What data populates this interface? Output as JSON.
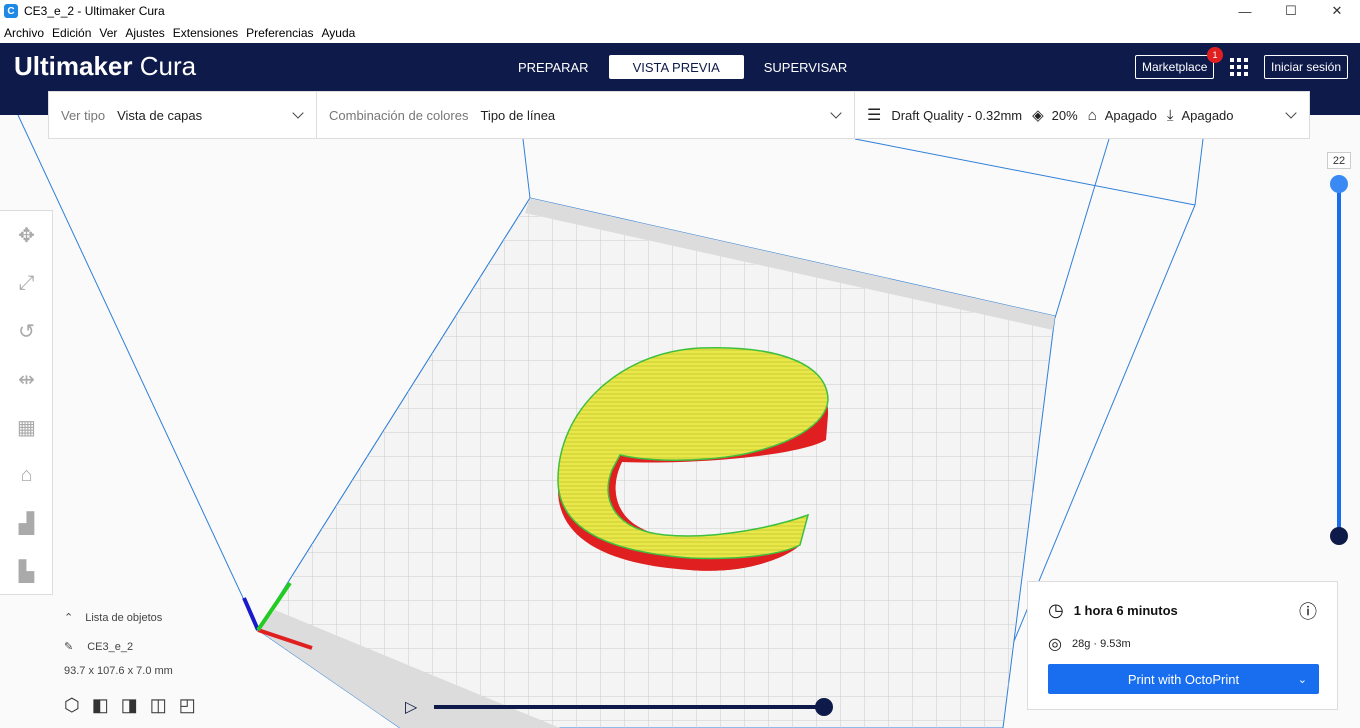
{
  "window": {
    "title": "CE3_e_2 - Ultimaker Cura",
    "icon": "C"
  },
  "window_controls": {
    "minimize": "—",
    "maximize": "☐",
    "close": "✕"
  },
  "menu": [
    "Archivo",
    "Edición",
    "Ver",
    "Ajustes",
    "Extensiones",
    "Preferencias",
    "Ayuda"
  ],
  "header": {
    "logo_bold": "Ultimaker",
    "logo_light": "Cura",
    "stages": [
      {
        "label": "PREPARAR",
        "active": false
      },
      {
        "label": "VISTA PREVIA",
        "active": true
      },
      {
        "label": "SUPERVISAR",
        "active": false
      }
    ],
    "marketplace_label": "Marketplace",
    "marketplace_badge": "1",
    "signin_label": "Iniciar sesión"
  },
  "toolbar": {
    "view_type_label": "Ver tipo",
    "view_type_value": "Vista de capas",
    "color_scheme_label": "Combinación de colores",
    "color_scheme_value": "Tipo de línea",
    "quality": "Draft Quality - 0.32mm",
    "infill": "20%",
    "support": "Apagado",
    "adhesion": "Apagado"
  },
  "layer_slider": {
    "current_layer": "22",
    "level": 1.0
  },
  "objects": {
    "header": "Lista de objetos",
    "item": "CE3_e_2",
    "dimensions": "93.7 x 107.6 x 7.0 mm"
  },
  "print_panel": {
    "time": "1 hora 6 minutos",
    "material": "28g · 9.53m",
    "button_label": "Print with OctoPrint"
  },
  "simulation": {
    "progress": 1.0
  },
  "colors": {
    "header_bg": "#0e1a4a",
    "accent": "#196ef0",
    "model_fill": "#e8e84a",
    "model_wall": "#e82020"
  }
}
